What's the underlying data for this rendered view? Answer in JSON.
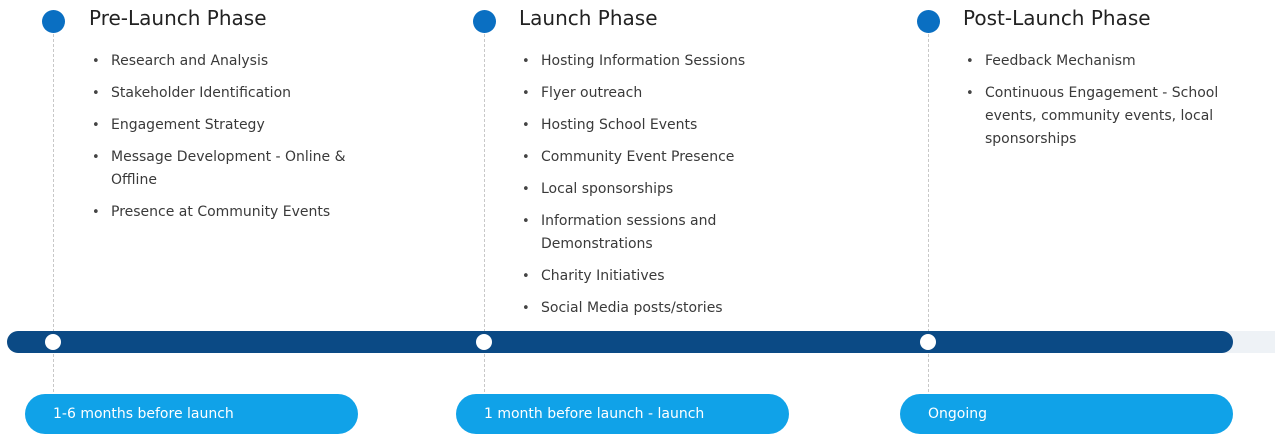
{
  "phases": [
    {
      "title": "Pre-Launch Phase",
      "items": [
        "Research and Analysis",
        "Stakeholder Identification",
        "Engagement Strategy",
        "Message Development - Online & Offline",
        "Presence at Community Events"
      ],
      "timeframe": "1-6 months before launch"
    },
    {
      "title": "Launch Phase",
      "items": [
        "Hosting Information Sessions",
        "Flyer outreach",
        "Hosting School Events",
        "Community Event Presence",
        "Local sponsorships",
        "Information sessions and Demonstrations",
        "Charity Initiatives",
        "Social Media posts/stories"
      ],
      "timeframe": "1 month before launch - launch"
    },
    {
      "title": "Post-Launch Phase",
      "items": [
        "Feedback Mechanism",
        "Continuous Engagement - School events, community events, local sponsorships"
      ],
      "timeframe": "Ongoing"
    }
  ],
  "colors": {
    "dot": "#0a6fc2",
    "timeline": "#0b4a85",
    "pill": "#10a2e8"
  }
}
